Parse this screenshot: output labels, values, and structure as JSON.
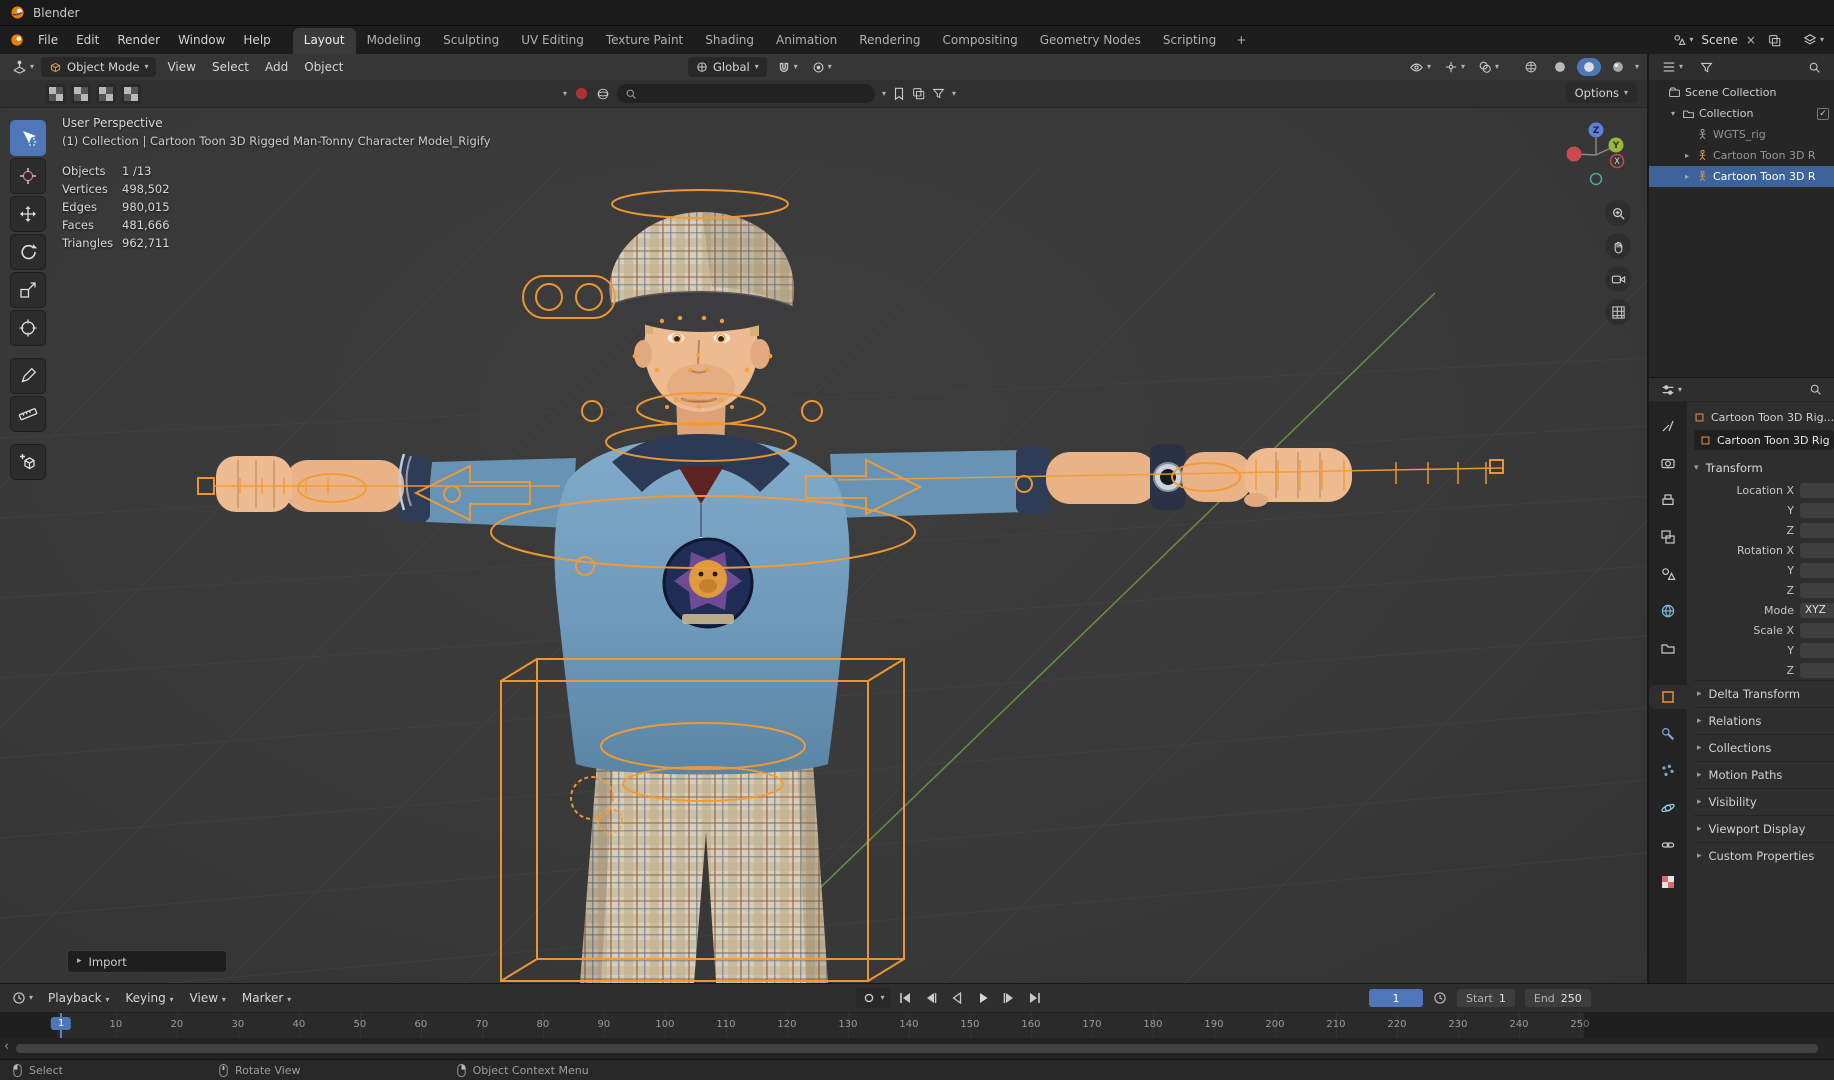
{
  "colors": {
    "accent": "#4772b3",
    "selection": "#3e639b",
    "rig_orange": "#f49b33",
    "frame_badge": "#4f76b8"
  },
  "titlebar": {
    "app_name": "Blender"
  },
  "menubar": {
    "menus": [
      "File",
      "Edit",
      "Render",
      "Window",
      "Help"
    ],
    "workspaces": [
      "Layout",
      "Modeling",
      "Sculpting",
      "UV Editing",
      "Texture Paint",
      "Shading",
      "Animation",
      "Rendering",
      "Compositing",
      "Geometry Nodes",
      "Scripting"
    ],
    "active_workspace": "Layout",
    "add_workspace_label": "+",
    "scene_selector": {
      "label": "Scene"
    }
  },
  "viewport_header": {
    "mode_selector": "Object Mode",
    "menus": [
      "View",
      "Select",
      "Add",
      "Object"
    ],
    "transform_orientation": "Global",
    "options_button": "Options"
  },
  "toolbar": {
    "tools": [
      "select-box",
      "cursor",
      "move",
      "rotate",
      "scale",
      "transform",
      "annotate",
      "measure",
      "add-cube"
    ],
    "active_tool": "select-box"
  },
  "viewport": {
    "view_label": "User Perspective",
    "context_label": "(1) Collection | Cartoon Toon 3D Rigged Man-Tonny Character Model_Rigify",
    "stats": [
      {
        "label": "Objects",
        "value": "1 /13"
      },
      {
        "label": "Vertices",
        "value": "498,502"
      },
      {
        "label": "Edges",
        "value": "980,015"
      },
      {
        "label": "Faces",
        "value": "481,666"
      },
      {
        "label": "Triangles",
        "value": "962,711"
      }
    ],
    "import_panel_label": "Import",
    "gizmo_axes": [
      "Z",
      "Y",
      "X"
    ]
  },
  "outliner": {
    "items": [
      {
        "label": "Scene Collection",
        "depth": 0,
        "icon": "scene-collection",
        "caret": ""
      },
      {
        "label": "Collection",
        "depth": 1,
        "icon": "collection",
        "caret": "▾",
        "checkbox": true
      },
      {
        "label": "WGTS_rig",
        "depth": 2,
        "icon": "armature-gray",
        "caret": "",
        "muted": true
      },
      {
        "label": "Cartoon Toon 3D R",
        "depth": 2,
        "icon": "armature-orange",
        "caret": "▸",
        "muted": true
      },
      {
        "label": "Cartoon Toon 3D R",
        "depth": 2,
        "icon": "armature-orange",
        "caret": "▸",
        "selected": true
      }
    ]
  },
  "properties": {
    "breadcrumb": "Cartoon Toon 3D Rig...",
    "name_field": "Cartoon Toon 3D Rig",
    "tabs": [
      "tool",
      "render",
      "output",
      "view-layer",
      "scene",
      "world",
      "collection",
      "object",
      "modifiers",
      "particles",
      "physics",
      "constraints",
      "texture"
    ],
    "active_tab": "object",
    "transform_title": "Transform",
    "transform_rows": [
      {
        "label": "Location X"
      },
      {
        "label": "Y"
      },
      {
        "label": "Z"
      },
      {
        "label": "Rotation X"
      },
      {
        "label": "Y"
      },
      {
        "label": "Z"
      },
      {
        "label": "Mode",
        "value": "XYZ"
      },
      {
        "label": "Scale X"
      },
      {
        "label": "Y"
      },
      {
        "label": "Z"
      }
    ],
    "sections": [
      "Delta Transform",
      "Relations",
      "Collections",
      "Motion Paths",
      "Visibility",
      "Viewport Display",
      "Custom Properties"
    ]
  },
  "timeline": {
    "menus": [
      "Playback",
      "Keying",
      "View",
      "Marker"
    ],
    "current_frame": "1",
    "start_label": "Start",
    "start_value": "1",
    "end_label": "End",
    "end_value": "250",
    "frame_start": 1,
    "frame_end": 250,
    "ticks": [
      10,
      20,
      30,
      40,
      50,
      60,
      70,
      80,
      90,
      100,
      110,
      120,
      130,
      140,
      150,
      160,
      170,
      180,
      190,
      200,
      210,
      220,
      230,
      240,
      250
    ]
  },
  "statusbar": {
    "items": [
      {
        "mouse": "left",
        "label": "Select"
      },
      {
        "mouse": "middle",
        "label": "Rotate View"
      },
      {
        "mouse": "right",
        "label": "Object Context Menu"
      }
    ]
  }
}
